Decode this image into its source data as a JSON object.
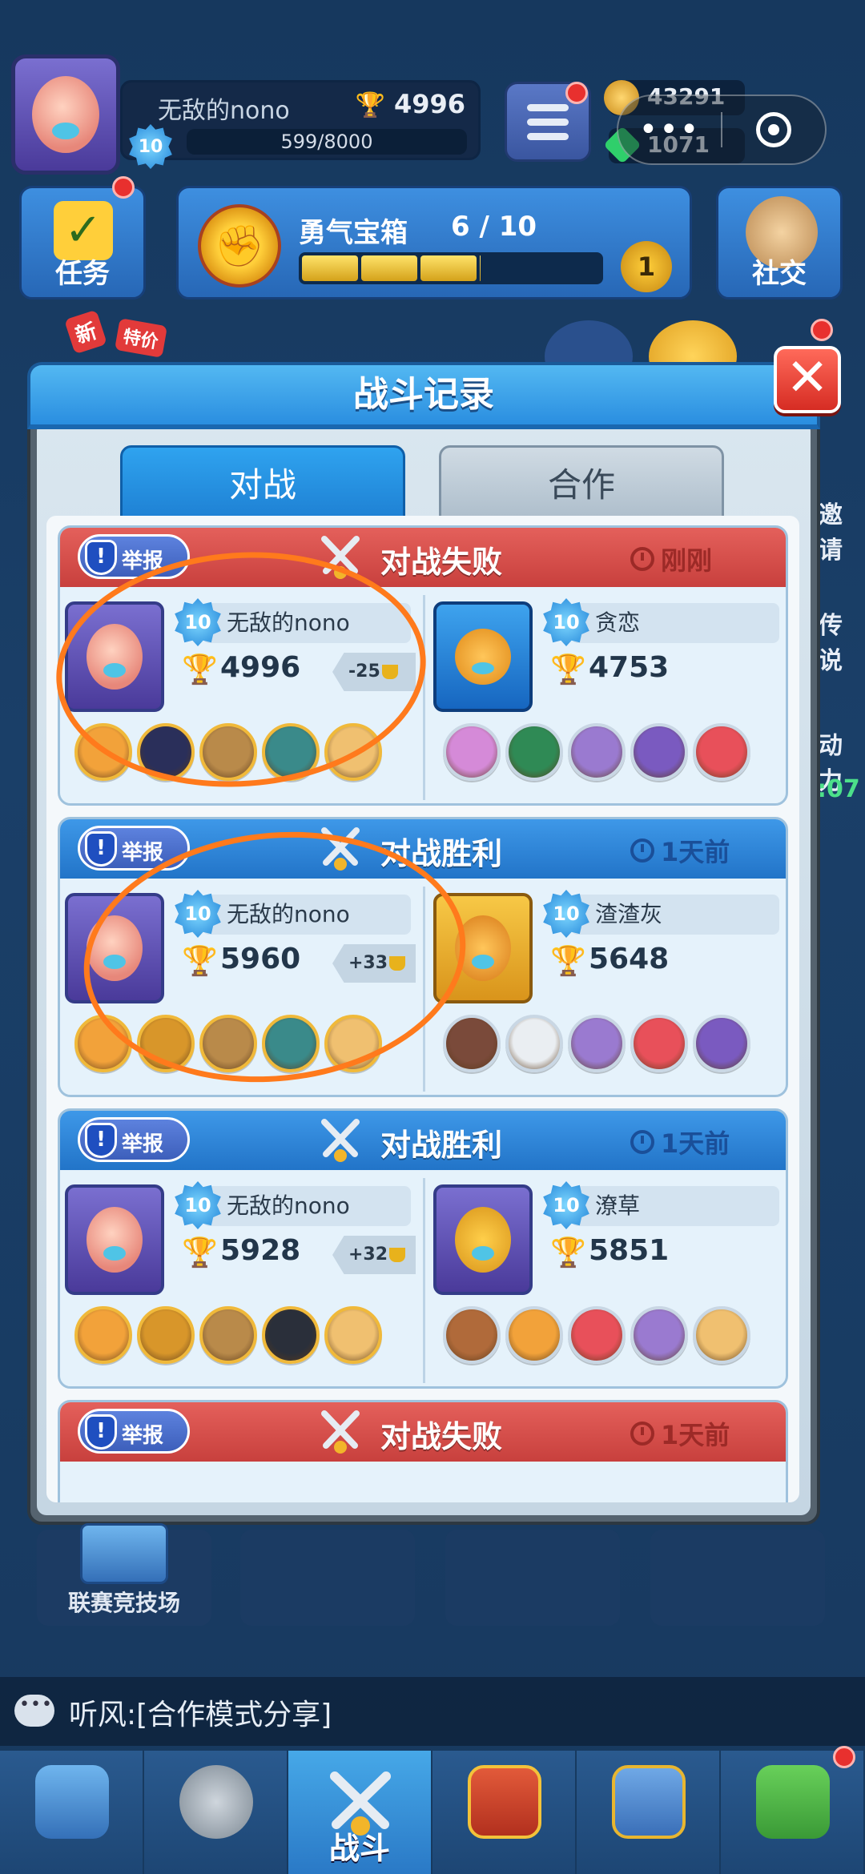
{
  "hud": {
    "player_name": "无敌的nono",
    "trophies": "4996",
    "level": "10",
    "xp": "599/8000",
    "coins": "43291",
    "gems": "1071",
    "capsule_more": "•••"
  },
  "row2": {
    "task_label": "任务",
    "chest_title": "勇气宝箱",
    "chest_progress": "6 / 10",
    "chest_progress_fraction": 0.6,
    "chest_count": "1",
    "social_label": "社交"
  },
  "promo": {
    "new_tag": "新",
    "sale_tag": "特价"
  },
  "side_peeks": {
    "right1": "邀请",
    "right2": "传说",
    "right3": "动力",
    "right4": ":07"
  },
  "modal": {
    "title": "战斗记录",
    "close_icon": "close-icon",
    "tabs": [
      {
        "label": "对战",
        "active": true
      },
      {
        "label": "合作",
        "active": false
      }
    ]
  },
  "records": [
    {
      "report_label": "举报",
      "result": "对战失败",
      "time": "刚刚",
      "type": "loss",
      "left": {
        "level": "10",
        "name": "无敌的nono",
        "trophies": "4996",
        "delta": "-25",
        "heroes": [
          "#f2a23a",
          "#2a2f5a",
          "#b98a4a",
          "#3a8a8a",
          "#f0c070"
        ]
      },
      "right": {
        "level": "10",
        "name": "贪恋",
        "trophies": "4753",
        "heroes": [
          "#d58ad8",
          "#2f8a55",
          "#9a7ad0",
          "#7a5ac0",
          "#e8505a"
        ]
      }
    },
    {
      "report_label": "举报",
      "result": "对战胜利",
      "time": "1天前",
      "type": "win",
      "left": {
        "level": "10",
        "name": "无敌的nono",
        "trophies": "5960",
        "delta": "+33",
        "heroes": [
          "#f2a23a",
          "#d8962a",
          "#b98a4a",
          "#3a8a8a",
          "#f0c070"
        ]
      },
      "right": {
        "level": "10",
        "name": "渣渣灰",
        "trophies": "5648",
        "heroes": [
          "#7a4a3a",
          "#eaeef2",
          "#9a7ad0",
          "#e8505a",
          "#7a5ac0"
        ]
      }
    },
    {
      "report_label": "举报",
      "result": "对战胜利",
      "time": "1天前",
      "type": "win",
      "left": {
        "level": "10",
        "name": "无敌的nono",
        "trophies": "5928",
        "delta": "+32",
        "heroes": [
          "#f2a23a",
          "#d8962a",
          "#b98a4a",
          "#2a2f3a",
          "#f0c070"
        ]
      },
      "right": {
        "level": "10",
        "name": "潦草",
        "trophies": "5851",
        "heroes": [
          "#b06a3a",
          "#f2a23a",
          "#e8505a",
          "#9a7ad0",
          "#f0c070"
        ]
      }
    },
    {
      "report_label": "举报",
      "result": "对战失败",
      "time": "1天前",
      "type": "loss"
    }
  ],
  "bottom": {
    "arena_label": "联赛竞技场",
    "chat_text": "听风:[合作模式分享]",
    "nav": [
      {
        "label": "",
        "icon": "chest-icon"
      },
      {
        "label": "",
        "icon": "helmet-icon"
      },
      {
        "label": "战斗",
        "icon": "swords-icon",
        "active": true
      },
      {
        "label": "",
        "icon": "crown-shield-icon"
      },
      {
        "label": "",
        "icon": "team-icon"
      },
      {
        "label": "",
        "icon": "sprout-icon"
      }
    ]
  },
  "colors": {
    "loss_header": "#d84c48",
    "win_header": "#2f86da",
    "annotation": "#ff7a1c"
  }
}
